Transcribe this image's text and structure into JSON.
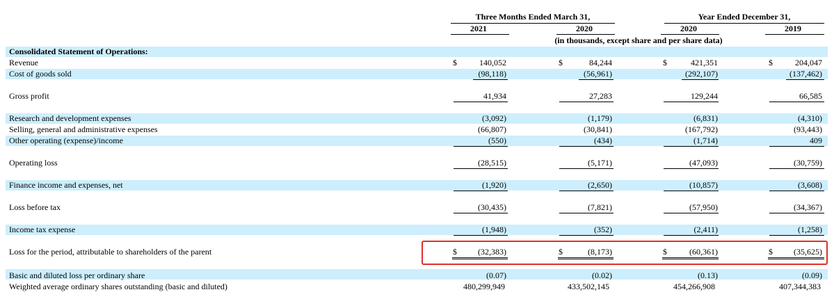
{
  "header": {
    "period_group_1": "Three Months Ended March 31,",
    "period_group_2": "Year Ended December 31,",
    "col_2021": "2021",
    "col_2020a": "2020",
    "col_2020b": "2020",
    "col_2019": "2019",
    "units_note": "(in thousands, except share and per share data)"
  },
  "section_title": "Consolidated Statement of Operations:",
  "currency_symbol": "$",
  "rows": {
    "revenue": {
      "label": "Revenue",
      "values": [
        "140,052",
        "84,244",
        "421,351",
        "204,047"
      ]
    },
    "cogs": {
      "label": "Cost of goods sold",
      "values": [
        "(98,118)",
        "(56,961)",
        "(292,107)",
        "(137,462)"
      ]
    },
    "gross_profit": {
      "label": "Gross profit",
      "values": [
        "41,934",
        "27,283",
        "129,244",
        "66,585"
      ]
    },
    "rnd": {
      "label": "Research and development expenses",
      "values": [
        "(3,092)",
        "(1,179)",
        "(6,831)",
        "(4,310)"
      ]
    },
    "sga": {
      "label": "Selling, general and administrative expenses",
      "values": [
        "(66,807)",
        "(30,841)",
        "(167,792)",
        "(93,443)"
      ]
    },
    "other_op": {
      "label": "Other operating (expense)/income",
      "values": [
        "(550)",
        "(434)",
        "(1,714)",
        "409"
      ]
    },
    "operating_loss": {
      "label": "Operating loss",
      "values": [
        "(28,515)",
        "(5,171)",
        "(47,093)",
        "(30,759)"
      ]
    },
    "finance": {
      "label": "Finance income and expenses, net",
      "values": [
        "(1,920)",
        "(2,650)",
        "(10,857)",
        "(3,608)"
      ]
    },
    "loss_before_tax": {
      "label": "Loss before tax",
      "values": [
        "(30,435)",
        "(7,821)",
        "(57,950)",
        "(34,367)"
      ]
    },
    "income_tax": {
      "label": "Income tax expense",
      "values": [
        "(1,948)",
        "(352)",
        "(2,411)",
        "(1,258)"
      ]
    },
    "loss_period": {
      "label": "Loss for the period, attributable to shareholders of the parent",
      "values": [
        "(32,383)",
        "(8,173)",
        "(60,361)",
        "(35,625)"
      ]
    },
    "eps": {
      "label": "Basic and diluted loss per ordinary share",
      "values": [
        "(0.07)",
        "(0.02)",
        "(0.13)",
        "(0.09)"
      ]
    },
    "shares": {
      "label": "Weighted average ordinary shares outstanding (basic and diluted)",
      "values": [
        "480,299,949",
        "433,502,145",
        "454,266,908",
        "407,344,383"
      ]
    }
  },
  "colors": {
    "band": "#cdeefc",
    "highlight": "#e0302a"
  }
}
